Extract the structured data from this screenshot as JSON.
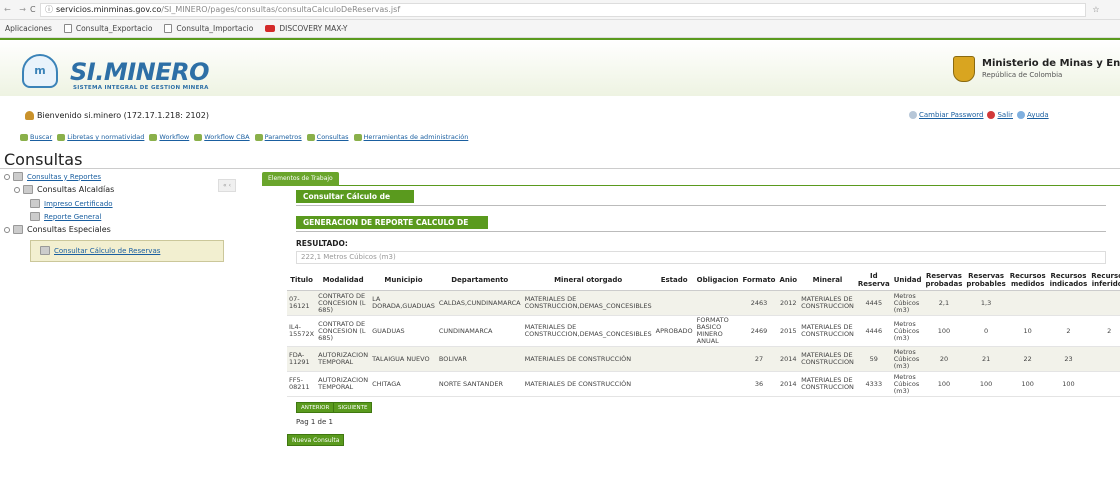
{
  "browser": {
    "nav": "← →",
    "reload": "C",
    "url_info": "ⓘ",
    "url_host": "servicios.minminas.gov.co",
    "url_path": "/SI_MINERO/pages/consultas/consultaCalculoDeReservas.jsf",
    "bookmarks": [
      "Aplicaciones",
      "Consulta_Exportacio",
      "Consulta_Importacio",
      "DISCOVERY MAX-Y"
    ]
  },
  "header": {
    "logo": "SI.MINERO",
    "logo_sub": "SISTEMA INTEGRAL DE GESTION MINERA",
    "ministry": "Ministerio de Minas y Energía",
    "ministry_sub": "República de Colombia",
    "crest_caption": "Escudo Colombia"
  },
  "user": {
    "welcome": "Bienvenido si.minero (172.17.1.218: 2102)",
    "links": [
      "Cambiar Password",
      "Salir",
      "Ayuda"
    ]
  },
  "menu": [
    "Buscar",
    "Libretas y normatividad",
    "Workflow",
    "Workflow CBA",
    "Parametros",
    "Consultas",
    "Herramientas de administración"
  ],
  "page_title": "Consultas",
  "tree": {
    "root": "Consultas y Reportes",
    "alcaldias": "Consultas Alcaldías",
    "impreso": "Impreso Certificado",
    "reporte": "Reporte General",
    "especiales": "Consultas Especiales",
    "calculo": "Consultar Cálculo de Reservas",
    "collapse": "« ‹"
  },
  "tab": "Elementos de Trabajo",
  "section_bar": "Consultar Cálculo de Reservas",
  "report_bar": "GENERACION DE REPORTE CALCULO DE RESERVAS:",
  "result_label": "RESULTADO:",
  "result_value": "222,1 Metros Cúbicos (m3)",
  "table": {
    "headers": [
      "Titulo",
      "Modalidad",
      "Municipio",
      "Departamento",
      "Mineral otorgado",
      "Estado",
      "Obligacion",
      "Formato",
      "Anio",
      "Mineral",
      "Id Reserva",
      "Unidad",
      "Reservas probadas",
      "Reservas probables",
      "Recursos medidos",
      "Recursos indicados",
      "Recursos inferidos"
    ],
    "rows": [
      [
        "07-16121",
        "CONTRATO DE CONCESION (L 685)",
        "LA DORADA,GUADUAS",
        "CALDAS,CUNDINAMARCA",
        "MATERIALES DE CONSTRUCCION,DEMAS_CONCESIBLES",
        "",
        "",
        "2463",
        "2012",
        "MATERIALES DE CONSTRUCCION",
        "4445",
        "Metros Cúbicos (m3)",
        "2,1",
        "1,3",
        "",
        "",
        ""
      ],
      [
        "IL4-15572X",
        "CONTRATO DE CONCESION (L 685)",
        "GUADUAS",
        "CUNDINAMARCA",
        "MATERIALES DE CONSTRUCCION,DEMAS_CONCESIBLES",
        "APROBADO",
        "FORMATO BASICO MINERO ANUAL",
        "2469",
        "2015",
        "MATERIALES DE CONSTRUCCION",
        "4446",
        "Metros Cúbicos (m3)",
        "100",
        "0",
        "10",
        "2",
        "2"
      ],
      [
        "FDA-11291",
        "AUTORIZACION TEMPORAL",
        "TALAIGUA NUEVO",
        "BOLIVAR",
        "MATERIALES DE CONSTRUCCIÓN",
        "",
        "",
        "27",
        "2014",
        "MATERIALES DE CONSTRUCCION",
        "59",
        "Metros Cúbicos (m3)",
        "20",
        "21",
        "22",
        "23",
        ""
      ],
      [
        "FF5-08211",
        "AUTORIZACION TEMPORAL",
        "CHITAGA",
        "NORTE SANTANDER",
        "MATERIALES DE CONSTRUCCIÓN",
        "",
        "",
        "36",
        "2014",
        "MATERIALES DE CONSTRUCCION",
        "4333",
        "Metros Cúbicos (m3)",
        "100",
        "100",
        "100",
        "100",
        ""
      ]
    ]
  },
  "pager": {
    "prev": "ANTERIOR",
    "next": "SIGUIENTE",
    "text": "Pag 1 de 1"
  },
  "new_query": "Nueva Consulta"
}
